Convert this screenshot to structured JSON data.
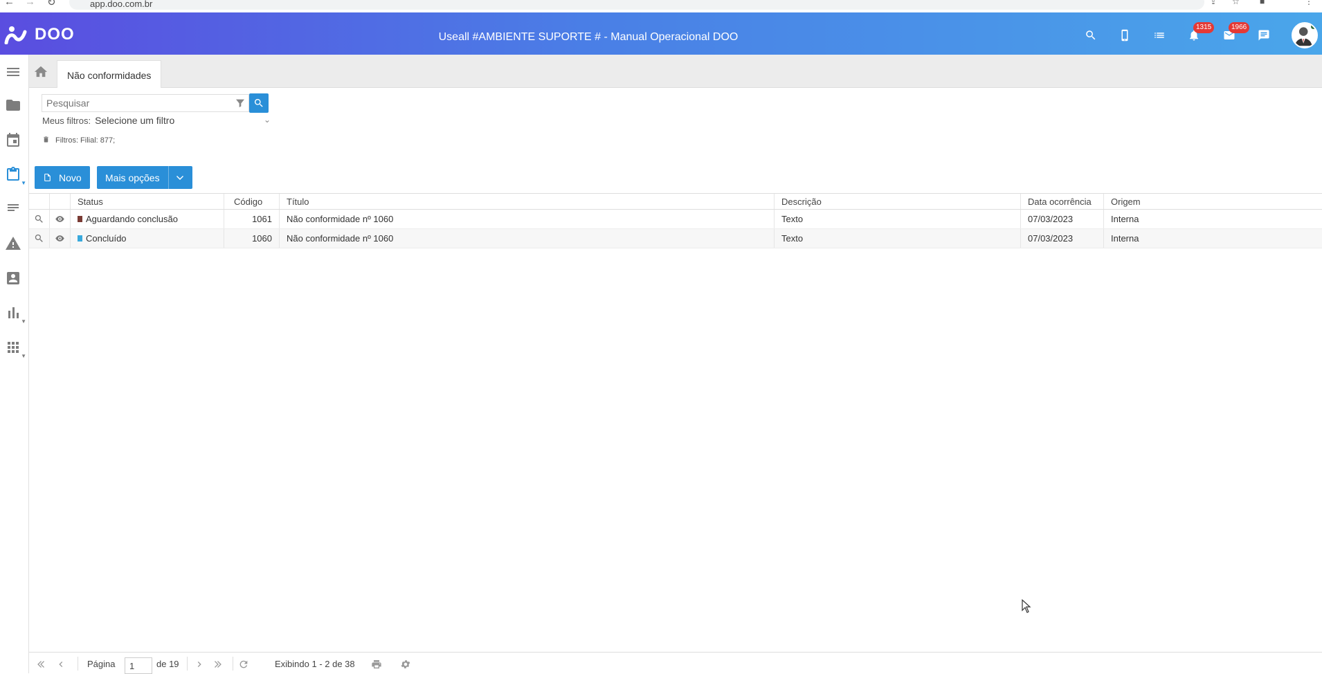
{
  "browser": {
    "url": "app.doo.com.br"
  },
  "header": {
    "logo_text": "DOO",
    "title": "Useall #AMBIENTE SUPORTE # - Manual Operacional DOO",
    "notifications_count": "1315",
    "messages_count": "1966"
  },
  "tabs": {
    "active": "Não conformidades"
  },
  "search": {
    "placeholder": "Pesquisar",
    "my_filters_label": "Meus filtros:",
    "my_filters_value": "Selecione um filtro",
    "active_filters": "Filtros: Filial: 877;"
  },
  "actions": {
    "new_label": "Novo",
    "more_label": "Mais opções"
  },
  "table": {
    "headers": {
      "status": "Status",
      "codigo": "Código",
      "titulo": "Título",
      "descricao": "Descrição",
      "data": "Data ocorrência",
      "origem": "Origem"
    },
    "rows": [
      {
        "status": "Aguardando conclusão",
        "status_color": "#7a3b34",
        "codigo": "1061",
        "titulo": "Não conformidade nº 1060",
        "descricao": "Texto",
        "data": "07/03/2023",
        "origem": "Interna"
      },
      {
        "status": "Concluído",
        "status_color": "#39a9dc",
        "codigo": "1060",
        "titulo": "Não conformidade nº 1060",
        "descricao": "Texto",
        "data": "07/03/2023",
        "origem": "Interna"
      }
    ]
  },
  "pager": {
    "page_label": "Página",
    "page_value": "1",
    "of_label": "de 19",
    "showing": "Exibindo 1 - 2 de 38"
  },
  "colors": {
    "header_start": "#5a4de0",
    "header_end": "#4aa6ea",
    "accent": "#2a8fd8"
  }
}
